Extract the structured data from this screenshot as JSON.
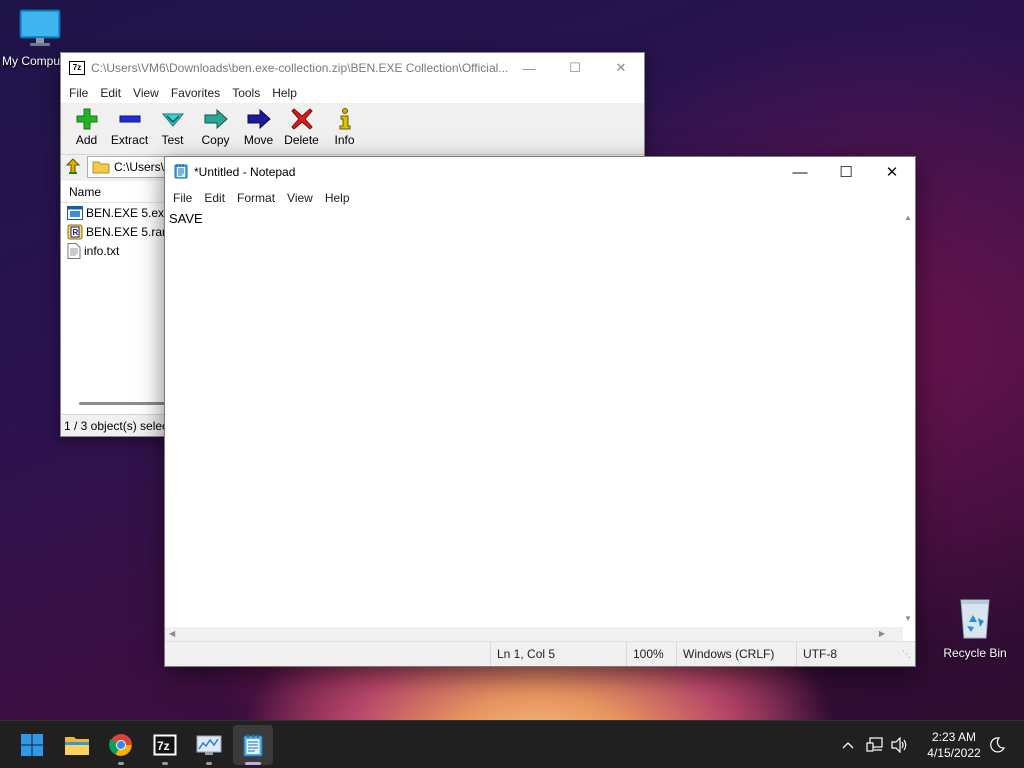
{
  "desktop": {
    "icons": [
      {
        "label": "My Compu"
      },
      {
        "label": "Recycle Bin"
      }
    ]
  },
  "sevenzip": {
    "app_icon": "7z",
    "title": "C:\\Users\\VM6\\Downloads\\ben.exe-collection.zip\\BEN.EXE Collection\\Official...",
    "menu": [
      "File",
      "Edit",
      "View",
      "Favorites",
      "Tools",
      "Help"
    ],
    "toolbar": [
      {
        "label": "Add",
        "icon": "plus-icon"
      },
      {
        "label": "Extract",
        "icon": "minus-icon"
      },
      {
        "label": "Test",
        "icon": "check-icon"
      },
      {
        "label": "Copy",
        "icon": "copy-arrow-icon"
      },
      {
        "label": "Move",
        "icon": "move-arrow-icon"
      },
      {
        "label": "Delete",
        "icon": "delete-x-icon"
      },
      {
        "label": "Info",
        "icon": "info-icon"
      }
    ],
    "address": "C:\\Users\\",
    "column_name": "Name",
    "files": [
      {
        "name": "BEN.EXE 5.exe",
        "icon": "exe-file-icon"
      },
      {
        "name": "BEN.EXE 5.rar",
        "icon": "rar-file-icon"
      },
      {
        "name": "info.txt",
        "icon": "text-file-icon"
      }
    ],
    "status": "1 / 3 object(s) selec"
  },
  "notepad": {
    "title": "*Untitled - Notepad",
    "menu": [
      "File",
      "Edit",
      "Format",
      "View",
      "Help"
    ],
    "content": "SAVE",
    "status": {
      "position": "Ln 1, Col 5",
      "zoom": "100%",
      "line_ending": "Windows (CRLF)",
      "encoding": "UTF-8"
    }
  },
  "taskbar": {
    "apps": [
      "start-icon",
      "file-explorer-icon",
      "chrome-icon",
      "7zip-icon",
      "resource-monitor-icon",
      "notepad-icon"
    ],
    "time": "2:23 AM",
    "date": "4/15/2022"
  },
  "colors": {
    "taskbar_bg": "#202020",
    "start_blue": "#2f9be8",
    "active_indicator": "#c8a8e8"
  }
}
